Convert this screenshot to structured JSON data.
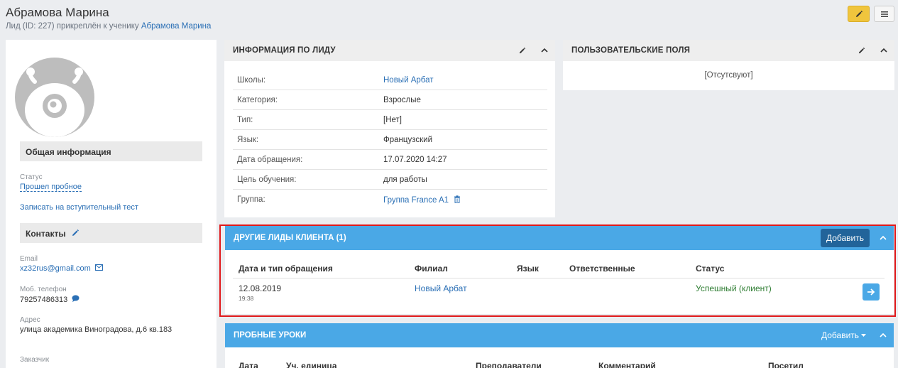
{
  "header": {
    "title": "Абрамова Марина",
    "subtitle_prefix": "Лид (ID: 227) прикреплён к ученику",
    "subtitle_link": "Абрамова Марина"
  },
  "left": {
    "general_title": "Общая информация",
    "status_label": "Статус",
    "status_value": "Прошел пробное",
    "entry_test_link": "Записать на вступительный тест",
    "contacts_title": "Контакты",
    "email_label": "Email",
    "email_value": "xz32rus@gmail.com",
    "phone_label": "Моб. телефон",
    "phone_value": "79257486313",
    "address_label": "Адрес",
    "address_value": "улица академика Виноградова, д.6 кв.183",
    "customer_label": "Заказчик"
  },
  "lead_info": {
    "title": "ИНФОРМАЦИЯ ПО ЛИДУ",
    "rows": [
      {
        "key": "Школы:",
        "value": "Новый Арбат"
      },
      {
        "key": "Категория:",
        "value": "Взрослые"
      },
      {
        "key": "Тип:",
        "value": "[Нет]"
      },
      {
        "key": "Язык:",
        "value": "Французский"
      },
      {
        "key": "Дата обращения:",
        "value": "17.07.2020 14:27"
      },
      {
        "key": "Цель обучения:",
        "value": "для работы"
      },
      {
        "key": "Группа:",
        "value": "Группа France A1"
      }
    ]
  },
  "custom_fields": {
    "title": "ПОЛЬЗОВАТЕЛЬСКИЕ ПОЛЯ",
    "empty": "[Отсутсвуют]"
  },
  "other_leads": {
    "title": "ДРУГИЕ ЛИДЫ КЛИЕНТА (1)",
    "add_button": "Добавить",
    "columns": [
      "Дата и тип обращения",
      "Филиал",
      "Язык",
      "Ответственные",
      "Статус"
    ],
    "rows": [
      {
        "date": "12.08.2019",
        "time": "19:38",
        "branch": "Новый Арбат",
        "language": "",
        "responsible": "",
        "status": "Успешный (клиент)"
      }
    ]
  },
  "trial_lessons": {
    "title": "ПРОБНЫЕ УРОКИ",
    "add_button": "Добавить",
    "columns": [
      "Дата",
      "Уч. единица",
      "Преподаватели",
      "Комментарий",
      "Посетил"
    ]
  },
  "colors": {
    "accent_blue": "#4aa8e6",
    "dark_blue_button": "#22649a",
    "edit_yellow": "#f0c53d",
    "success_green": "#2e7d32",
    "highlight_red": "#e0191b"
  }
}
